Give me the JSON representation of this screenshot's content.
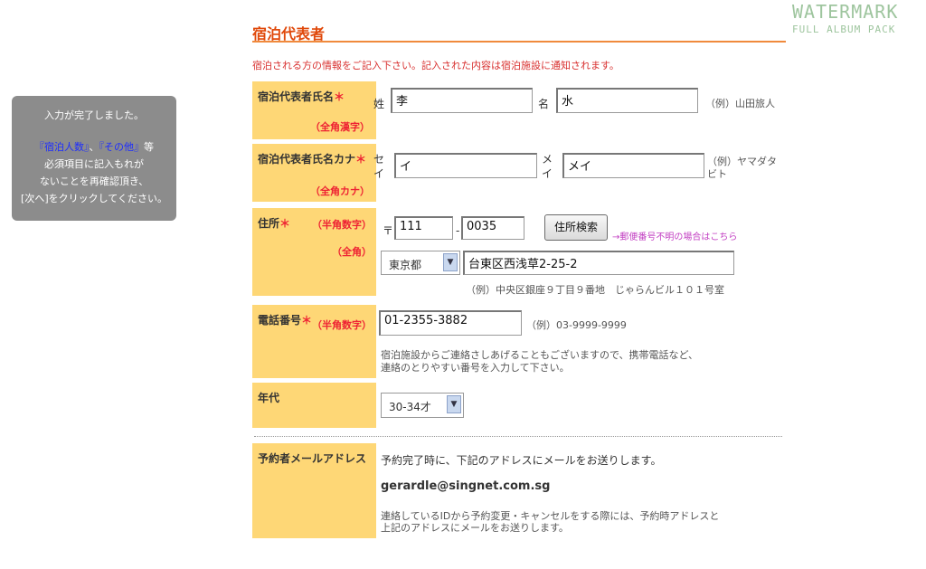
{
  "watermark": {
    "line1": "WATERMARK",
    "line2": "FULL ALBUM PACK"
  },
  "notice": {
    "line1": "入力が完了しました。",
    "hl1": "『宿泊人数』",
    "sep": "、",
    "hl2": "『その他』",
    "tail": "等",
    "line3": "必須項目に記入もれが",
    "line4": "ないことを再確認頂き、",
    "line5": "[次へ]をクリックしてください。"
  },
  "section": {
    "title": "宿泊代表者",
    "intro": "宿泊される方の情報をご記入下さい。記入された内容は宿泊施設に通知されます。"
  },
  "name": {
    "label": "宿泊代表者氏名",
    "req": "＊",
    "note": "（全角漢字）",
    "sei_label": "姓",
    "sei_value": "李",
    "mei_label": "名",
    "mei_value": "水",
    "example": "（例）山田旅人"
  },
  "kana": {
    "label": "宿泊代表者氏名カナ",
    "req": "＊",
    "note": "（全角カナ）",
    "sei_label1": "セ",
    "sei_label2": "イ",
    "sei_value": "イ",
    "mei_label1": "メ",
    "mei_label2": "イ",
    "mei_value": "メイ",
    "example1": "（例）ヤマダタ",
    "example2": "ビト"
  },
  "address": {
    "label": "住所",
    "req": "＊",
    "note1": "（半角数字）",
    "note2": "（全角）",
    "postal_mark": "〒",
    "zip1": "111",
    "dash": "-",
    "zip2": "0035",
    "search_button": "住所検索",
    "unknown_link": "→郵便番号不明の場合はこちら",
    "prefecture": "東京都",
    "street": "台東区西浅草2-25-2",
    "example": "（例）中央区銀座９丁目９番地　じゃらんビル１０１号室"
  },
  "phone": {
    "label": "電話番号",
    "req": "＊",
    "note": "（半角数字）",
    "value": "01-2355-3882",
    "example": "（例）03-9999-9999",
    "help1": "宿泊施設からご連絡さしあげることもございますので、携帯電話など、",
    "help2": "連絡のとりやすい番号を入力して下さい。"
  },
  "age": {
    "label": "年代",
    "value": "30-34才"
  },
  "email": {
    "label": "予約者メールアドレス",
    "intro": "予約完了時に、下記のアドレスにメールをお送りします。",
    "address": "gerardle@singnet.com.sg",
    "help1": "連絡しているIDから予約変更・キャンセルをする際には、予約時アドレスと",
    "help2": "上記のアドレスにメールをお送りします。"
  }
}
